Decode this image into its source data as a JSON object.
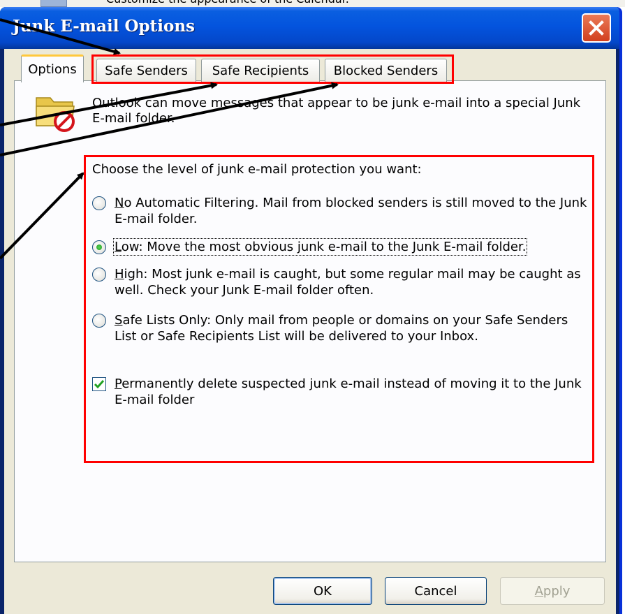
{
  "background_window": {
    "text": "Customize the appearance of the Calendar."
  },
  "dialog": {
    "title": "Junk E-mail Options",
    "close_label": "✕"
  },
  "tabs": [
    {
      "label": "Options",
      "active": true
    },
    {
      "label": "Safe Senders",
      "active": false
    },
    {
      "label": "Safe Recipients",
      "active": false
    },
    {
      "label": "Blocked Senders",
      "active": false
    }
  ],
  "intro_text": "Outlook can move messages that appear to be junk e-mail into a special Junk E-mail folder.",
  "icons": {
    "folder": "junk-folder-blocked-icon"
  },
  "protection": {
    "label": "Choose the level of junk e-mail protection you want:",
    "options": [
      {
        "key": "N",
        "rest": "o Automatic Filtering.  Mail from blocked senders is still moved to the Junk E-mail folder.",
        "checked": false
      },
      {
        "key": "L",
        "rest": "ow: Move the most obvious junk e-mail to the Junk E-mail folder.",
        "checked": true
      },
      {
        "key": "H",
        "rest": "igh: Most junk e-mail is caught, but some regular mail may be caught as well. Check your Junk E-mail folder often.",
        "checked": false
      },
      {
        "key": "S",
        "rest": "afe Lists Only: Only mail from people or domains on your Safe Senders List or Safe Recipients List will be delivered to your Inbox.",
        "checked": false
      }
    ]
  },
  "permanent_delete": {
    "key": "P",
    "rest": "ermanently delete suspected junk e-mail instead of moving it to the Junk E-mail folder",
    "checked": true
  },
  "buttons": {
    "ok": "OK",
    "cancel": "Cancel",
    "apply_key": "A",
    "apply_rest": "pply"
  },
  "colors": {
    "highlight_box": "#ff0000",
    "title_bar": "#0454de",
    "tab_hover": "#ffc83c",
    "checkmark": "#21a121"
  }
}
